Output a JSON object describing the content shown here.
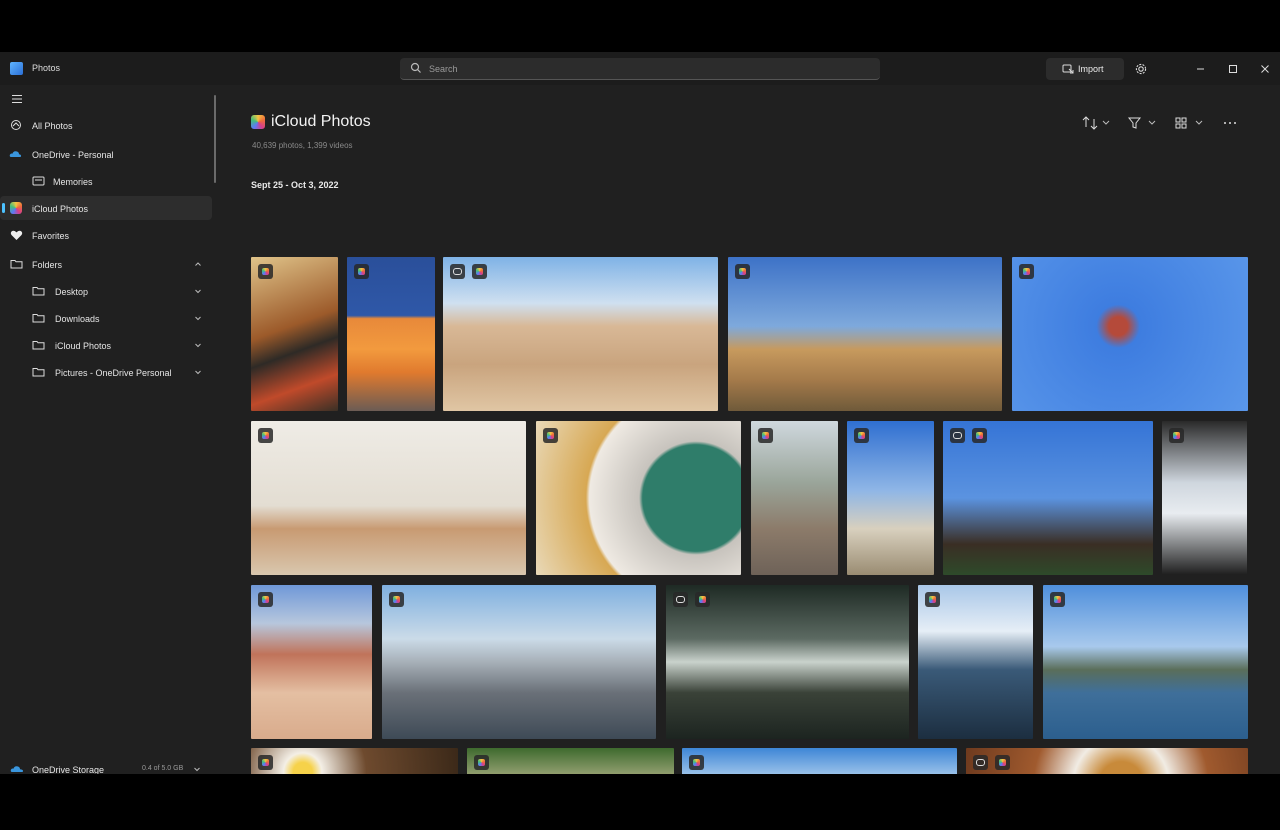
{
  "app": {
    "title": "Photos"
  },
  "search": {
    "placeholder": "Search"
  },
  "titlebar": {
    "import_label": "Import"
  },
  "sidebar": {
    "items": [
      {
        "label": "All Photos"
      },
      {
        "label": "OneDrive - Personal"
      },
      {
        "label": "Memories"
      },
      {
        "label": "iCloud Photos"
      },
      {
        "label": "Favorites"
      },
      {
        "label": "Folders"
      },
      {
        "label": "Desktop"
      },
      {
        "label": "Downloads"
      },
      {
        "label": "iCloud Photos"
      },
      {
        "label": "Pictures - OneDrive Personal"
      }
    ],
    "storage": {
      "label": "OneDrive Storage",
      "amount": "0.4 of 5.0 GB",
      "used_fraction": 0.15
    }
  },
  "main": {
    "title": "iCloud Photos",
    "subtitle": "40,639 photos, 1,399 videos",
    "group_date": "Sept 25 - Oct 3, 2022"
  },
  "colors": {
    "accent": "#4cc2ff",
    "background": "#202020",
    "sidebar_active": "#2d2d2d"
  },
  "photos": [
    {
      "subject": "shakshuka-food",
      "live": false
    },
    {
      "subject": "orange-sun-shadow",
      "live": false
    },
    {
      "subject": "desert-rocks-hiker",
      "live": true
    },
    {
      "subject": "joshua-trees",
      "live": false
    },
    {
      "subject": "swing-ride-tower",
      "live": false
    },
    {
      "subject": "dog-on-chair",
      "live": false
    },
    {
      "subject": "pear-tart-latte",
      "live": false
    },
    {
      "subject": "dog-on-street",
      "live": false
    },
    {
      "subject": "bikes-beach",
      "live": false
    },
    {
      "subject": "eiffel-tower",
      "live": true
    },
    {
      "subject": "louvre-pyramid",
      "live": false
    },
    {
      "subject": "desert-dune-hiker",
      "live": false
    },
    {
      "subject": "city-skyline-mountains",
      "live": false
    },
    {
      "subject": "forest-sunbeams",
      "live": true
    },
    {
      "subject": "sunset-shore",
      "live": false
    },
    {
      "subject": "coastal-lake",
      "live": false
    },
    {
      "subject": "ramen-egg",
      "live": false
    },
    {
      "subject": "dog-in-park",
      "live": false
    },
    {
      "subject": "clouds-sky",
      "live": false
    },
    {
      "subject": "plated-dessert",
      "live": true
    }
  ]
}
